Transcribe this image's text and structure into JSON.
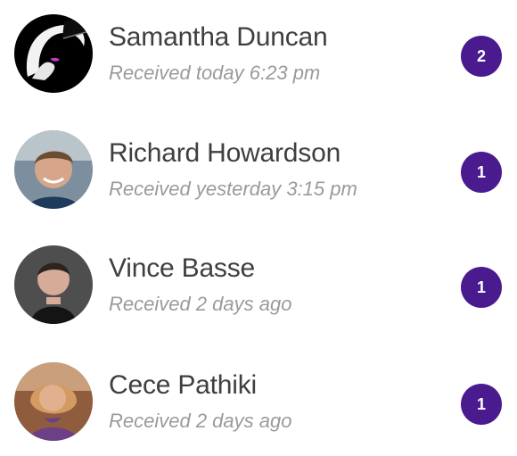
{
  "messages": [
    {
      "name": "Samantha Duncan",
      "received": "Received today 6:23 pm",
      "unread": "2",
      "avatar": "stylized-face-avatar"
    },
    {
      "name": "Richard Howardson",
      "received": "Received yesterday 3:15 pm",
      "unread": "1",
      "avatar": "person-photo-avatar"
    },
    {
      "name": "Vince Basse",
      "received": "Received 2 days ago",
      "unread": "1",
      "avatar": "person-photo-avatar"
    },
    {
      "name": "Cece Pathiki",
      "received": "Received 2 days ago",
      "unread": "1",
      "avatar": "person-photo-avatar"
    }
  ],
  "colors": {
    "badge": "#4a1a8f",
    "name_text": "#3f3f3f",
    "meta_text": "#9a9a9a"
  }
}
